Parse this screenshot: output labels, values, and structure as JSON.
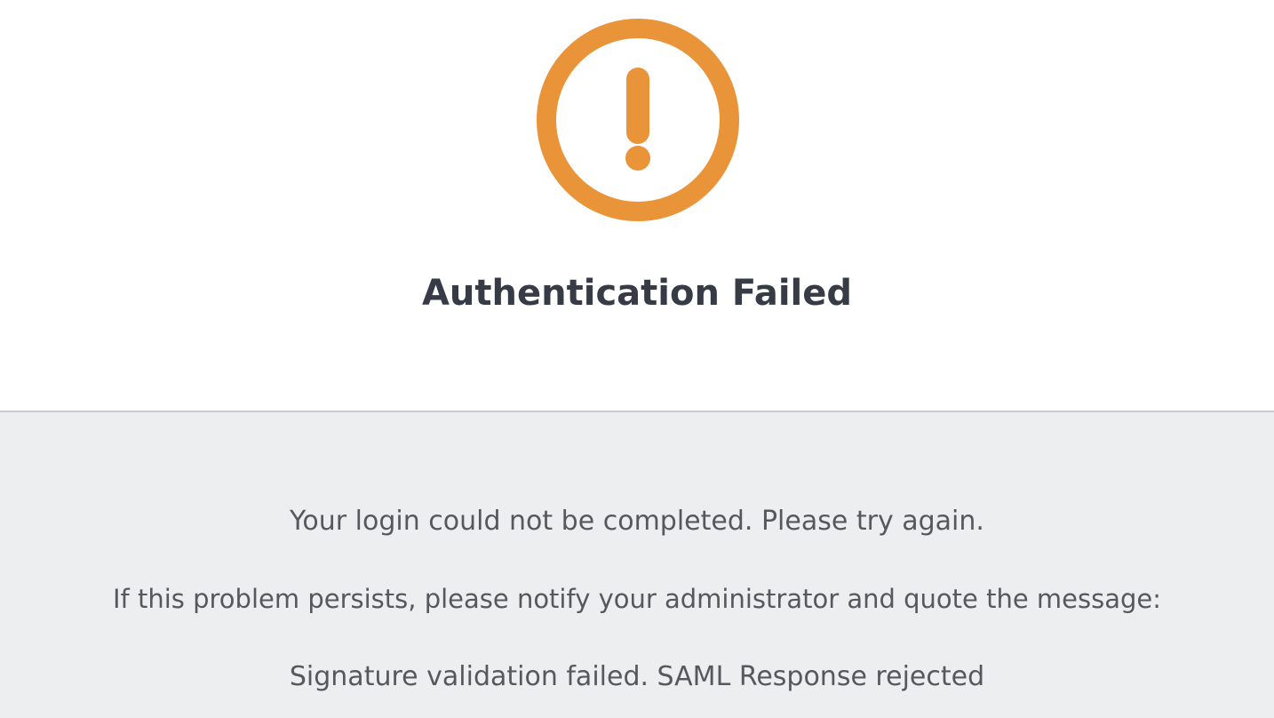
{
  "icon": {
    "name": "exclamation-circle-icon",
    "color": "#ea943a"
  },
  "title": "Authentication Failed",
  "messages": {
    "retry": "Your login could not be completed. Please try again.",
    "persist": "If this problem persists, please notify your administrator and quote the message:",
    "error": "Signature validation failed. SAML Response rejected"
  },
  "colors": {
    "title": "#363b45",
    "text": "#56585c",
    "panel_background": "#edeef0",
    "divider": "#c9cbd0"
  }
}
